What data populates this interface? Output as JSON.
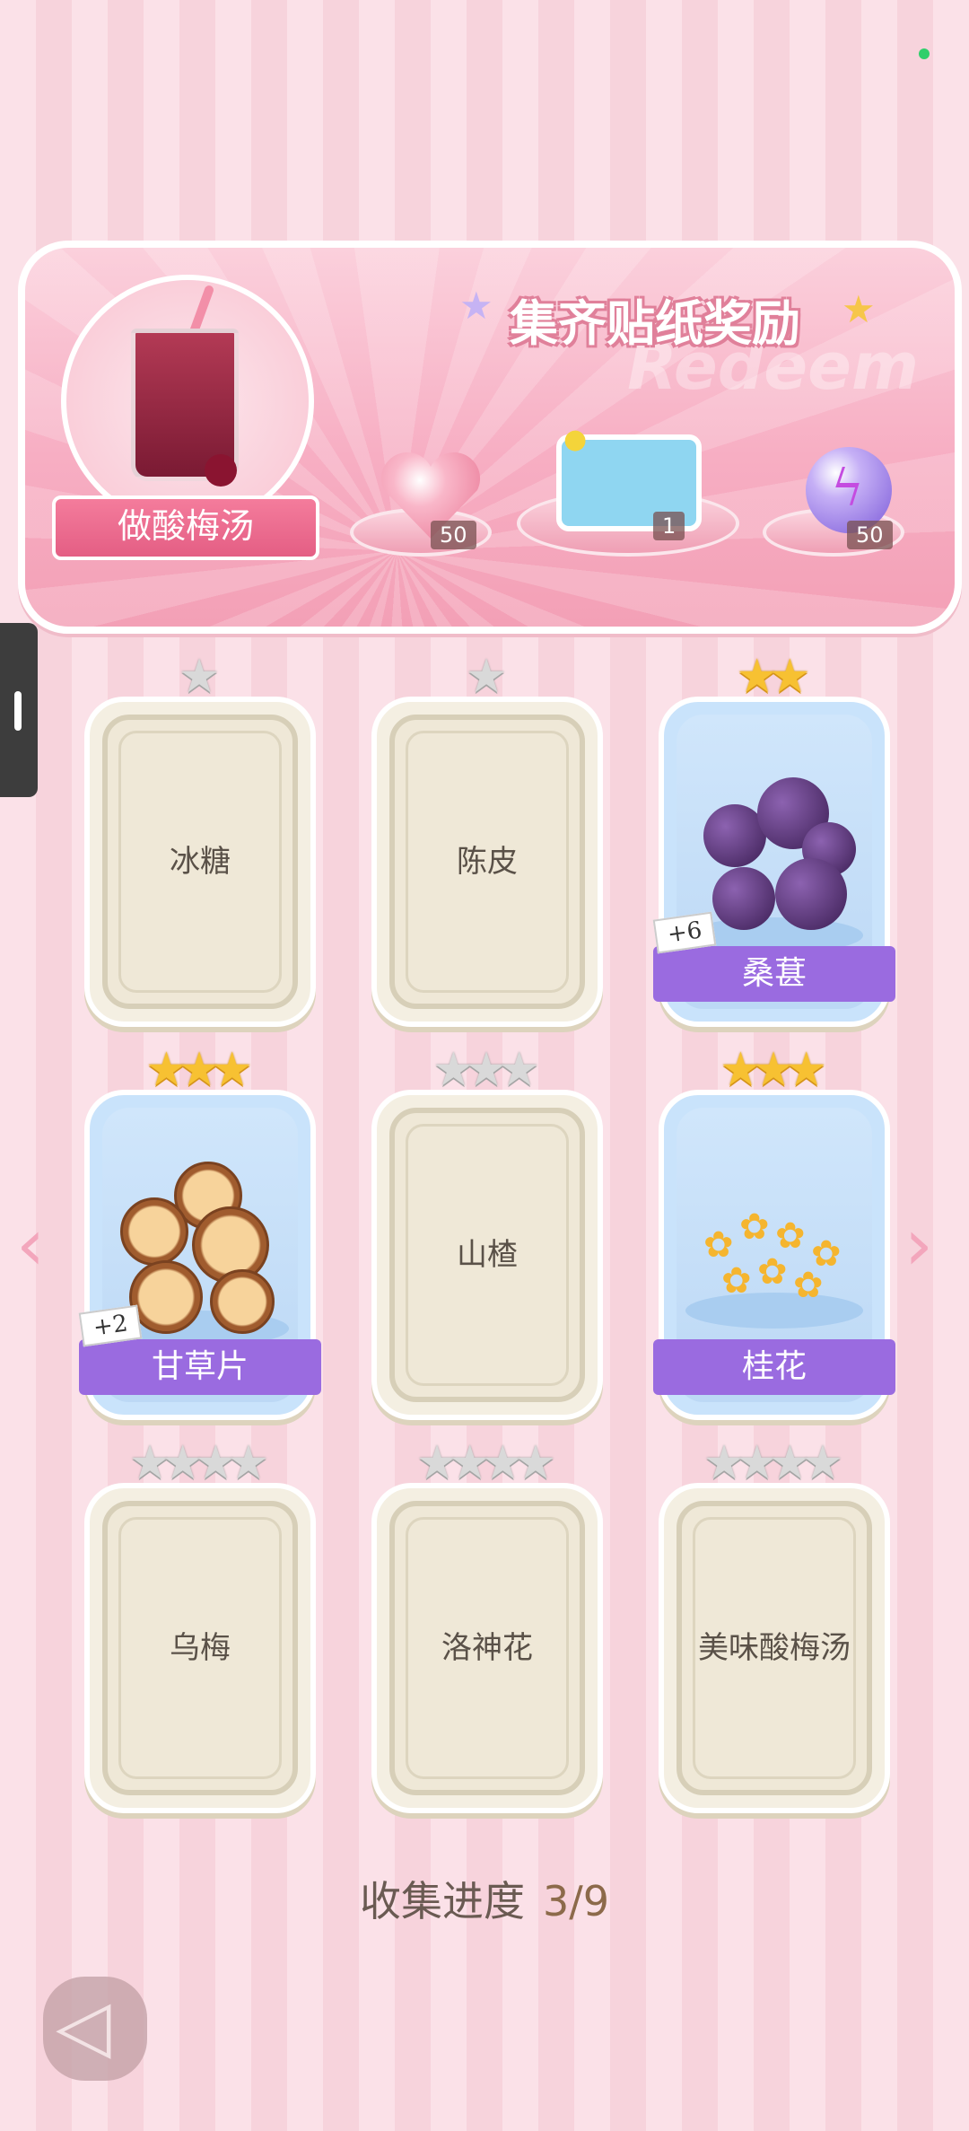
{
  "banner": {
    "title": "集齐贴纸奖励",
    "watermark": "Redeem",
    "recipe_label": "做酸梅汤",
    "rewards": [
      {
        "icon": "heart-gem-icon",
        "count": "50"
      },
      {
        "icon": "card-sticker-icon",
        "count": "1"
      },
      {
        "icon": "energy-orb-icon",
        "count": "50"
      }
    ]
  },
  "cards": [
    {
      "name": "冰糖",
      "stars": 1,
      "collected": false
    },
    {
      "name": "陈皮",
      "stars": 1,
      "collected": false
    },
    {
      "name": "桑葚",
      "stars": 2,
      "collected": true,
      "extra": "+6"
    },
    {
      "name": "甘草片",
      "stars": 3,
      "collected": true,
      "extra": "+2"
    },
    {
      "name": "山楂",
      "stars": 3,
      "collected": false
    },
    {
      "name": "桂花",
      "stars": 3,
      "collected": true
    },
    {
      "name": "乌梅",
      "stars": 4,
      "collected": false
    },
    {
      "name": "洛神花",
      "stars": 4,
      "collected": false
    },
    {
      "name": "美味酸梅汤",
      "stars": 4,
      "collected": false
    }
  ],
  "progress": {
    "label": "收集进度",
    "value": "3/9"
  },
  "nav": {
    "prev": "‹",
    "next": "›"
  },
  "colors": {
    "accent": "#9a6be0",
    "star": "#f7c132",
    "banner": "#f7aec3"
  }
}
